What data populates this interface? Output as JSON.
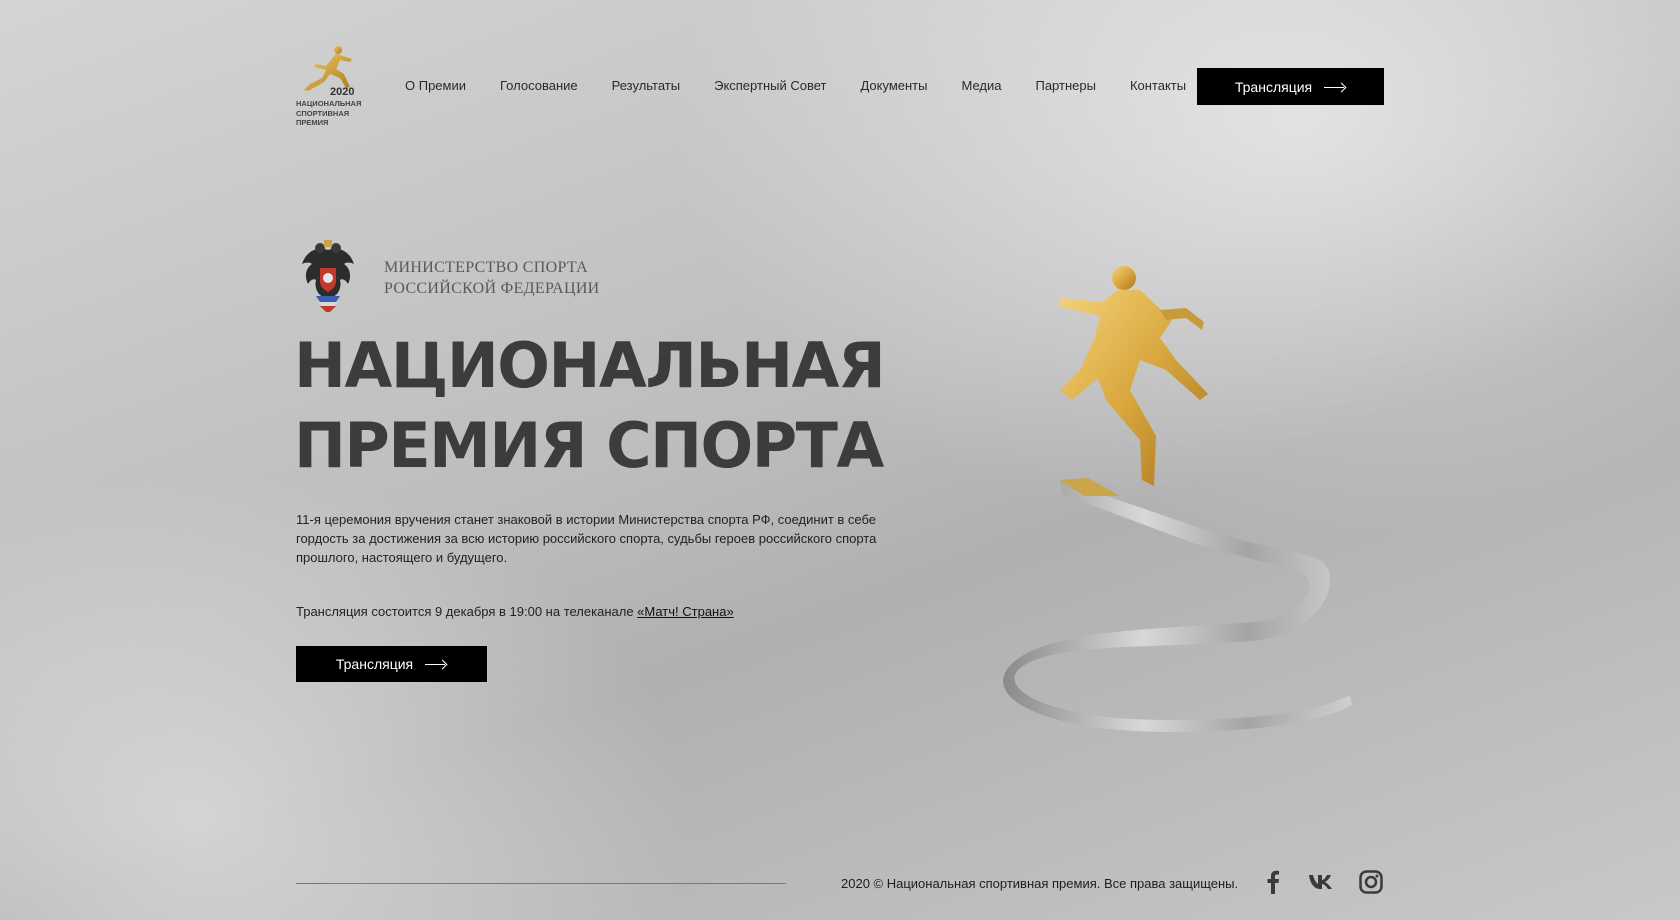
{
  "logo": {
    "year": "2020",
    "lines": [
      "НАЦИОНАЛЬНАЯ",
      "СПОРТИВНАЯ",
      "ПРЕМИЯ"
    ]
  },
  "nav": {
    "items": [
      "О Премии",
      "Голосование",
      "Результаты",
      "Экспертный Совет",
      "Документы",
      "Медиа",
      "Партнеры",
      "Контакты"
    ],
    "cta_label": "Трансляция"
  },
  "ministry": {
    "line1": "МИНИСТЕРСТВО СПОРТА",
    "line2": "РОССИЙСКОЙ ФЕДЕРАЦИИ"
  },
  "hero": {
    "title_line1": "НАЦИОНАЛЬНАЯ",
    "title_line2": "ПРЕМИЯ СПОРТА",
    "description": "11-я церемония вручения станет знаковой в истории Министерства спорта РФ, соединит в себе гордость за достижения за всю историю российского спорта, судьбы героев российского спорта прошлого, настоящего и будущего.",
    "broadcast_text": "Трансляция состоится 9 декабря в 19:00 на телеканале ",
    "broadcast_link": "«Матч! Страна»",
    "cta_label": "Трансляция"
  },
  "footer": {
    "copyright": "2020 © Национальная спортивная премия. Все права защищены."
  },
  "colors": {
    "button_bg": "#000000",
    "title": "#3c3c3c",
    "gold": "#d4a53c"
  },
  "icons": {
    "social": [
      "facebook-icon",
      "vk-icon",
      "instagram-icon"
    ]
  }
}
